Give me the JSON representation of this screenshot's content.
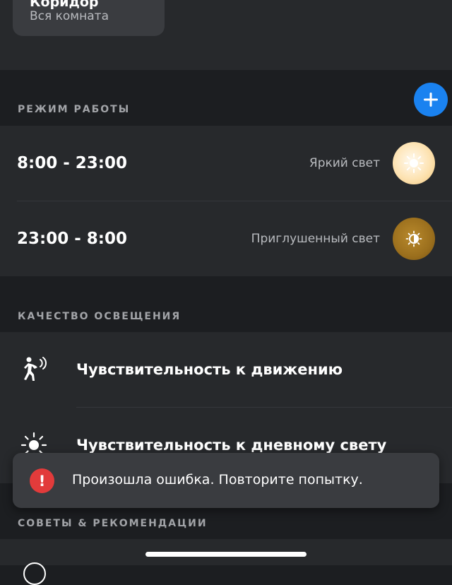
{
  "room": {
    "name": "Коридор",
    "scope": "Вся комната"
  },
  "schedule": {
    "header": "РЕЖИМ РАБОТЫ",
    "add_icon": "plus-icon",
    "accent_color": "#1a82f0",
    "rows": [
      {
        "time": "8:00 - 23:00",
        "scene": "Яркий свет",
        "icon": "sun-icon"
      },
      {
        "time": "23:00 - 8:00",
        "scene": "Приглушенный свет",
        "icon": "half-sun-icon"
      }
    ]
  },
  "lighting_quality": {
    "header": "КАЧЕСТВО ОСВЕЩЕНИЯ",
    "items": [
      {
        "label": "Чувствительность к движению",
        "icon": "motion-sensor-icon"
      },
      {
        "label": "Чувствительность к дневному свету",
        "icon": "daylight-icon"
      }
    ]
  },
  "tips": {
    "header": "СОВЕТЫ & РЕКОМЕНДАЦИИ"
  },
  "toast": {
    "message": "Произошла ошибка. Повторите попытку.",
    "icon": "error-icon",
    "icon_color": "#e23b3b"
  }
}
